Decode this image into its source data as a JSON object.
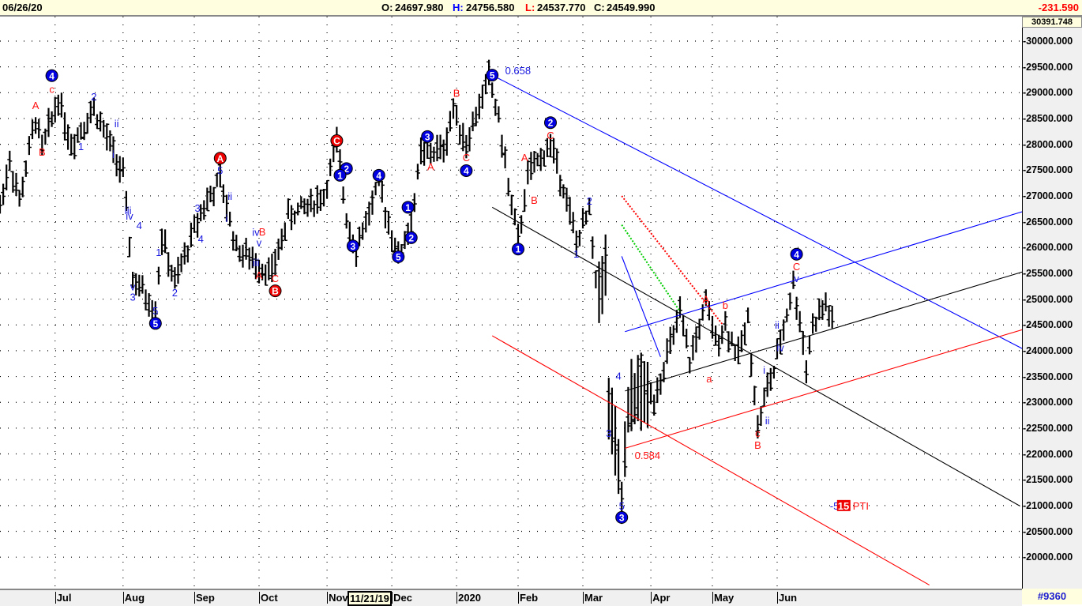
{
  "header": {
    "date": "06/26/20",
    "o_label": "O:",
    "o": "24697.980",
    "h_label": "H:",
    "h": "24756.580",
    "l_label": "L:",
    "l": "24537.770",
    "c_label": "C:",
    "c": "24549.990",
    "change": "-231.590"
  },
  "axis": {
    "top_value": "30391.748",
    "footer_id": "#9360",
    "cursor_date": "11/21/19"
  },
  "colors": {
    "up": "#000000",
    "blue": "#0000ff",
    "red": "#ff0000",
    "wave_blue": "#1010d0",
    "header_bg": "#ffffe0"
  },
  "chart_data": {
    "type": "bar",
    "title": "",
    "ylabel": "",
    "ylim": [
      19500,
      30391.748
    ],
    "yticks": [
      20000,
      20500,
      21000,
      21500,
      22000,
      22500,
      23000,
      23500,
      24000,
      24500,
      25000,
      25500,
      26000,
      26500,
      27000,
      27500,
      28000,
      28500,
      29000,
      29500,
      30000
    ],
    "ytick_labels": [
      "20000.000",
      "20500.000",
      "21000.000",
      "21500.000",
      "22000.000",
      "22500.000",
      "23000.000",
      "23500.000",
      "24000.000",
      "24500.000",
      "25000.000",
      "25500.000",
      "26000.000",
      "26500.000",
      "27000.000",
      "27500.000",
      "28000.000",
      "28500.000",
      "29000.000",
      "29500.000",
      "30000.000"
    ],
    "months": [
      {
        "label": "Jul",
        "day": 17
      },
      {
        "label": "Aug",
        "day": 38
      },
      {
        "label": "Sep",
        "day": 60
      },
      {
        "label": "Oct",
        "day": 80
      },
      {
        "label": "Nov",
        "day": 101
      },
      {
        "label": "Dec",
        "day": 121
      },
      {
        "label": "2020",
        "day": 141
      },
      {
        "label": "Feb",
        "day": 160
      },
      {
        "label": "Mar",
        "day": 180
      },
      {
        "label": "Apr",
        "day": 201
      },
      {
        "label": "May",
        "day": 220
      },
      {
        "label": "Jun",
        "day": 240
      }
    ],
    "price_pivots": [
      [
        0,
        26800
      ],
      [
        3,
        27700
      ],
      [
        6,
        26900
      ],
      [
        11,
        28500
      ],
      [
        13,
        27900
      ],
      [
        18,
        28900
      ],
      [
        22,
        28000
      ],
      [
        29,
        28700
      ],
      [
        38,
        27400
      ],
      [
        41,
        25400
      ],
      [
        48,
        24800
      ],
      [
        50,
        26200
      ],
      [
        54,
        25300
      ],
      [
        62,
        26700
      ],
      [
        68,
        27300
      ],
      [
        73,
        26000
      ],
      [
        79,
        25700
      ],
      [
        84,
        25500
      ],
      [
        89,
        26600
      ],
      [
        100,
        27000
      ],
      [
        104,
        28000
      ],
      [
        107,
        26600
      ],
      [
        110,
        26000
      ],
      [
        117,
        27200
      ],
      [
        123,
        25800
      ],
      [
        127,
        26500
      ],
      [
        130,
        27800
      ],
      [
        137,
        27900
      ],
      [
        140,
        28700
      ],
      [
        144,
        28000
      ],
      [
        151,
        29300
      ],
      [
        154,
        28500
      ],
      [
        157,
        27200
      ],
      [
        160,
        26100
      ],
      [
        163,
        27400
      ],
      [
        170,
        28000
      ],
      [
        174,
        27200
      ],
      [
        178,
        26100
      ],
      [
        182,
        26700
      ],
      [
        184,
        25300
      ],
      [
        187,
        25500
      ],
      [
        188,
        23000
      ],
      [
        192,
        21100
      ],
      [
        194,
        22700
      ],
      [
        196,
        23200
      ],
      [
        202,
        23100
      ],
      [
        210,
        24700
      ],
      [
        213,
        23800
      ],
      [
        218,
        24900
      ],
      [
        221,
        24200
      ],
      [
        224,
        24500
      ],
      [
        228,
        23900
      ],
      [
        231,
        24600
      ],
      [
        234,
        22500
      ],
      [
        237,
        23300
      ],
      [
        239,
        23600
      ],
      [
        245,
        25300
      ],
      [
        248,
        24200
      ],
      [
        249,
        23700
      ],
      [
        251,
        24500
      ],
      [
        255,
        24900
      ],
      [
        257,
        24550
      ]
    ],
    "trendlines": [
      {
        "color": "#0000ff",
        "from": [
          152,
          29340
        ],
        "to": [
          334,
          23450
        ]
      },
      {
        "color": "#0000ff",
        "from": [
          193,
          24370
        ],
        "to": [
          334,
          27040
        ]
      },
      {
        "color": "#000000",
        "from": [
          152,
          26780
        ],
        "to": [
          315,
          20990
        ]
      },
      {
        "color": "#000000",
        "from": [
          193,
          23220
        ],
        "to": [
          334,
          25870
        ]
      },
      {
        "color": "#ff0000",
        "from": [
          193,
          22110
        ],
        "to": [
          334,
          24750
        ]
      },
      {
        "color": "#ff0000",
        "from": [
          152,
          24290
        ],
        "to": [
          287,
          19460
        ]
      },
      {
        "color": "#ff0000",
        "from": [
          192,
          27000
        ],
        "to": [
          223,
          24520
        ],
        "dotted": true
      },
      {
        "color": "#00cc00",
        "from": [
          192,
          26440
        ],
        "to": [
          210,
          24760
        ],
        "dotted": true
      },
      {
        "color": "#0000ff",
        "from": [
          192,
          25830
        ],
        "to": [
          204,
          23880
        ]
      }
    ],
    "annotations": [
      {
        "t": "4",
        "c": "blue",
        "circle": true,
        "day": 16,
        "price": 29330
      },
      {
        "t": "5",
        "c": "blue",
        "circle": true,
        "day": 152,
        "price": 29340
      },
      {
        "t": "2",
        "c": "blue",
        "circle": true,
        "day": 170,
        "price": 28420
      },
      {
        "t": "3",
        "c": "blue",
        "circle": true,
        "day": 132,
        "price": 28150
      },
      {
        "t": "4",
        "c": "blue",
        "circle": true,
        "day": 144,
        "price": 27490
      },
      {
        "t": "1",
        "c": "blue",
        "circle": true,
        "day": 160,
        "price": 25970
      },
      {
        "t": "3",
        "c": "blue",
        "circle": true,
        "day": 192,
        "price": 20770
      },
      {
        "t": "4",
        "c": "blue",
        "circle": true,
        "day": 246,
        "price": 25870
      },
      {
        "t": "3",
        "c": "blue",
        "circle": true,
        "day": 109,
        "price": 26030
      },
      {
        "t": "5",
        "c": "blue",
        "circle": true,
        "day": 123,
        "price": 25820
      },
      {
        "t": "4",
        "c": "blue",
        "circle": true,
        "day": 117,
        "price": 27400
      },
      {
        "t": "1",
        "c": "blue",
        "circle": true,
        "day": 126,
        "price": 26780
      },
      {
        "t": "2",
        "c": "blue",
        "circle": true,
        "day": 127,
        "price": 26190
      },
      {
        "t": "2",
        "c": "blue",
        "circle": true,
        "day": 107,
        "price": 27530
      },
      {
        "t": "1",
        "c": "blue",
        "circle": true,
        "day": 105,
        "price": 27400
      },
      {
        "t": "5",
        "c": "blue",
        "circle": true,
        "day": 48,
        "price": 24530
      },
      {
        "t": "A",
        "c": "red",
        "circle": true,
        "day": 68,
        "price": 27730
      },
      {
        "t": "C",
        "c": "red",
        "circle": true,
        "day": 104,
        "price": 28070
      },
      {
        "t": "B",
        "c": "red",
        "circle": true,
        "day": 85,
        "price": 25160
      },
      {
        "t": "A",
        "c": "red",
        "day": 11,
        "price": 28760
      },
      {
        "t": "B",
        "c": "red",
        "day": 13,
        "price": 27860
      },
      {
        "t": "c",
        "c": "red",
        "day": 16,
        "price": 29070
      },
      {
        "t": "B",
        "c": "red",
        "day": 141,
        "price": 29000
      },
      {
        "t": "C",
        "c": "red",
        "day": 144,
        "price": 27750
      },
      {
        "t": "A",
        "c": "red",
        "day": 133,
        "price": 27570
      },
      {
        "t": "A",
        "c": "red",
        "day": 162,
        "price": 27750
      },
      {
        "t": "B",
        "c": "red",
        "day": 165,
        "price": 26920
      },
      {
        "t": "C",
        "c": "red",
        "day": 170,
        "price": 28180
      },
      {
        "t": "A",
        "c": "red",
        "day": 218,
        "price": 25000
      },
      {
        "t": "b",
        "c": "red",
        "day": 224,
        "price": 24890
      },
      {
        "t": "a",
        "c": "red",
        "day": 219,
        "price": 23460
      },
      {
        "t": "c",
        "c": "red",
        "day": 234,
        "price": 22410
      },
      {
        "t": "B",
        "c": "red",
        "day": 234,
        "price": 22180
      },
      {
        "t": "C",
        "c": "red",
        "day": 246,
        "price": 25640
      },
      {
        "t": "A",
        "c": "red",
        "day": 80,
        "price": 25470
      },
      {
        "t": "C",
        "c": "red",
        "day": 85,
        "price": 25410
      },
      {
        "t": "B",
        "c": "red",
        "day": 81,
        "price": 26310
      },
      {
        "t": "0.584",
        "c": "red",
        "day": 196,
        "price": 21980
      },
      {
        "t": "0.658",
        "c": "blue",
        "day": 156,
        "price": 29430
      },
      {
        "t": "2",
        "c": "blue",
        "day": 29,
        "price": 28930
      },
      {
        "t": "1",
        "c": "blue",
        "day": 25,
        "price": 27960
      },
      {
        "t": "ii",
        "c": "blue",
        "day": 36,
        "price": 28410
      },
      {
        "t": "i",
        "c": "blue",
        "day": 35,
        "price": 27810
      },
      {
        "t": "iii",
        "c": "blue",
        "day": 38.5,
        "price": 26720
      },
      {
        "t": "iv",
        "c": "blue",
        "day": 40,
        "price": 26620
      },
      {
        "t": "4",
        "c": "blue",
        "day": 43,
        "price": 26430
      },
      {
        "t": "v",
        "c": "blue",
        "day": 41,
        "price": 25250
      },
      {
        "t": "3",
        "c": "blue",
        "day": 41,
        "price": 25050
      },
      {
        "t": "5",
        "c": "blue",
        "day": 48,
        "price": 24780
      },
      {
        "t": "1",
        "c": "blue",
        "day": 49,
        "price": 25910
      },
      {
        "t": "2",
        "c": "blue",
        "day": 54,
        "price": 25130
      },
      {
        "t": "4",
        "c": "blue",
        "day": 62,
        "price": 26170
      },
      {
        "t": "3",
        "c": "blue",
        "day": 61,
        "price": 26770
      },
      {
        "t": "5",
        "c": "blue",
        "day": 68,
        "price": 27500
      },
      {
        "t": "ii",
        "c": "blue",
        "day": 71,
        "price": 27000
      },
      {
        "t": "i",
        "c": "blue",
        "day": 70,
        "price": 26570
      },
      {
        "t": "iv",
        "c": "blue",
        "day": 79,
        "price": 26300
      },
      {
        "t": "v",
        "c": "blue",
        "day": 80,
        "price": 26100
      },
      {
        "t": "iii",
        "c": "blue",
        "day": 78,
        "price": 25710
      },
      {
        "t": "2",
        "c": "blue",
        "day": 182,
        "price": 26910
      },
      {
        "t": "1",
        "c": "blue",
        "day": 178,
        "price": 25880
      },
      {
        "t": "4",
        "c": "blue",
        "day": 191,
        "price": 23520
      },
      {
        "t": "3",
        "c": "blue",
        "day": 188,
        "price": 22410
      },
      {
        "t": "5",
        "c": "blue",
        "day": 192,
        "price": 21000
      },
      {
        "t": "i",
        "c": "blue",
        "day": 236,
        "price": 23630
      },
      {
        "t": "ii",
        "c": "blue",
        "day": 237,
        "price": 22650
      },
      {
        "t": "ii",
        "c": "blue",
        "day": 240,
        "price": 24500
      },
      {
        "t": "iv",
        "c": "blue",
        "day": 241,
        "price": 24070
      },
      {
        "t": "v",
        "c": "blue",
        "day": 246,
        "price": 25410
      }
    ],
    "pti": {
      "prefix": "-5",
      "value": "15",
      "label": "PTI",
      "day": 258,
      "price": 21000
    }
  }
}
